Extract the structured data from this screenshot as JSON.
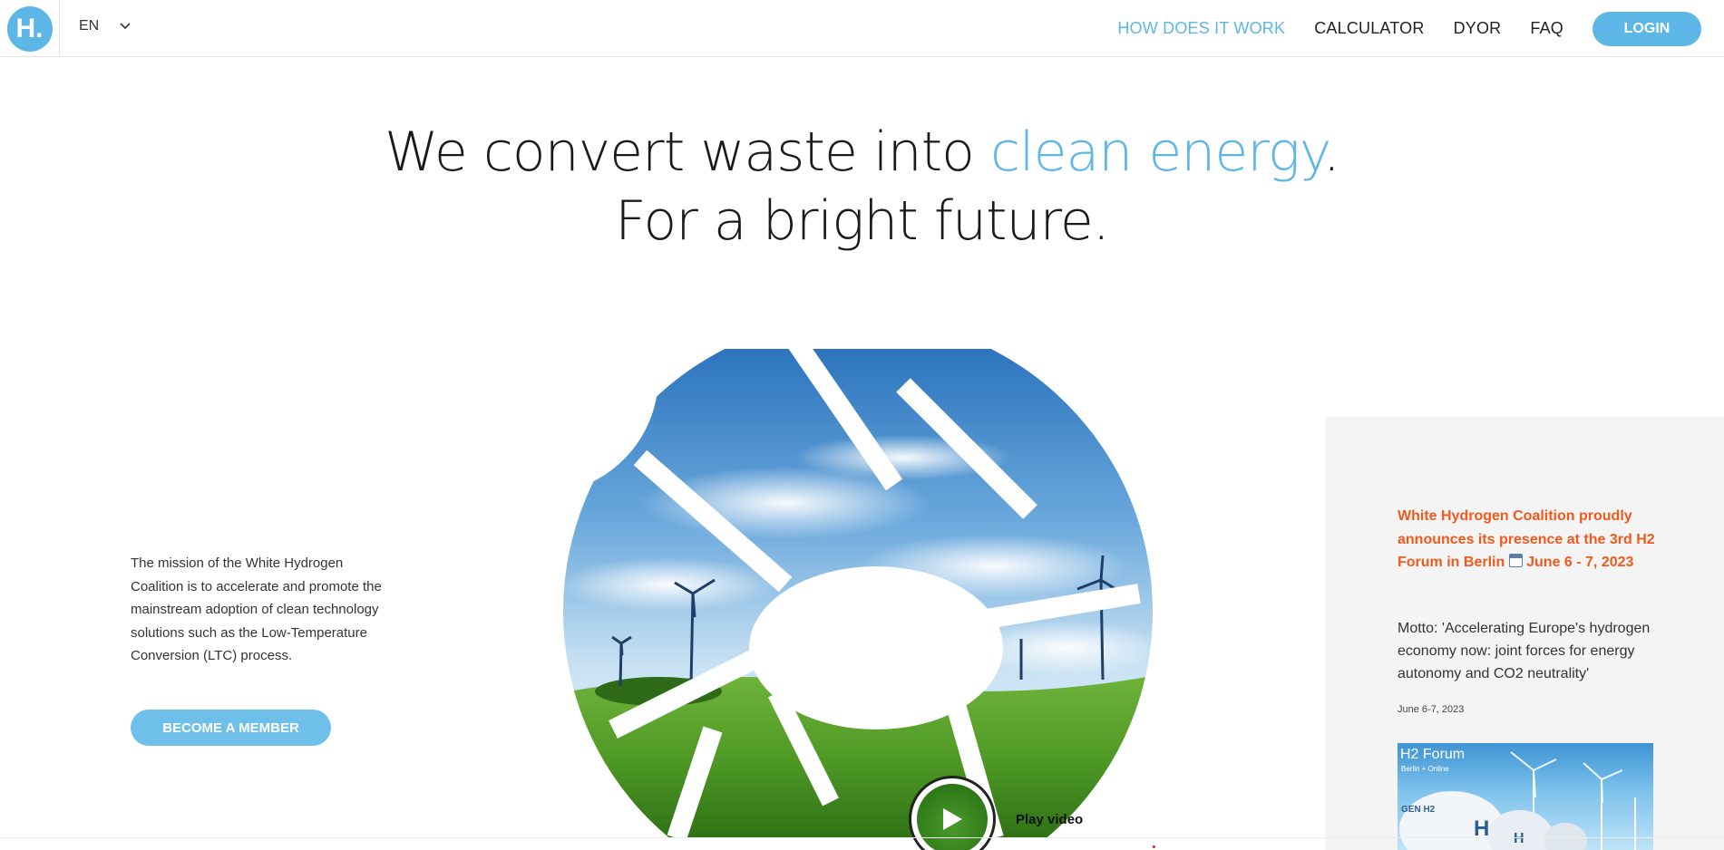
{
  "header": {
    "logo_text": "H.",
    "language": "EN",
    "nav": [
      {
        "label": "HOW DOES IT WORK",
        "active": true
      },
      {
        "label": "CALCULATOR",
        "active": false
      },
      {
        "label": "DYOR",
        "active": false
      },
      {
        "label": "FAQ",
        "active": false
      }
    ],
    "login_label": "LOGIN"
  },
  "hero": {
    "line1_pre": "We convert waste into ",
    "line1_accent": "clean energy",
    "line1_post": ".",
    "line2": "For a bright future."
  },
  "mission": {
    "text": "The mission of the White Hydrogen Coalition is to accelerate and promote the mainstream adoption of clean technology solutions such as the Low-Temperature Conversion (LTC) process.",
    "button_label": "BECOME A MEMBER"
  },
  "video": {
    "play_label": "Play video"
  },
  "news": {
    "title_part1": "White Hydrogen Coalition proudly announces its presence at the 3rd H2 Forum in Berlin ",
    "title_part2": " June 6 - 7, 2023",
    "text": "Motto: 'Accelerating Europe's hydrogen economy now: joint forces for energy autonomy and CO2 neutrality'",
    "date": "June 6-7, 2023",
    "image_title": "H2 Forum",
    "image_subtitle": "Berlin + Online",
    "image_tank_text": "GEN H2"
  },
  "colors": {
    "accent": "#5cb7e6",
    "news_title": "#f05a1c",
    "panel_bg": "#f4f4f4"
  }
}
